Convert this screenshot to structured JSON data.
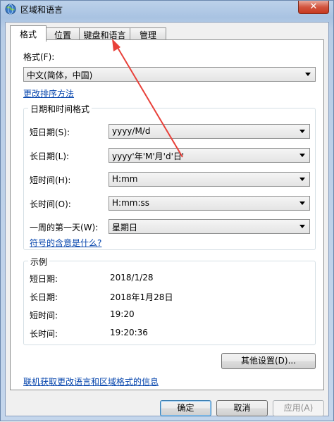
{
  "window": {
    "title": "区域和语言",
    "close_label": "✕"
  },
  "tabs": [
    {
      "label": "格式",
      "active": true
    },
    {
      "label": "位置",
      "active": false
    },
    {
      "label": "键盘和语言",
      "active": false
    },
    {
      "label": "管理",
      "active": false
    }
  ],
  "format": {
    "label": "格式(F):",
    "value": "中文(简体，中国)",
    "sort_link": "更改排序方法"
  },
  "datetime_group": {
    "title": "日期和时间格式",
    "rows": [
      {
        "label": "短日期(S):",
        "value": "yyyy/M/d"
      },
      {
        "label": "长日期(L):",
        "value": "yyyy'年'M'月'd'日'"
      },
      {
        "label": "短时间(H):",
        "value": "H:mm"
      },
      {
        "label": "长时间(O):",
        "value": "H:mm:ss"
      },
      {
        "label": "一周的第一天(W):",
        "value": "星期日"
      }
    ],
    "symbol_link": "符号的含意是什么?"
  },
  "example_group": {
    "title": "示例",
    "rows": [
      {
        "label": "短日期:",
        "value": "2018/1/28"
      },
      {
        "label": "长日期:",
        "value": "2018年1月28日"
      },
      {
        "label": "短时间:",
        "value": "19:20"
      },
      {
        "label": "长时间:",
        "value": "19:20:36"
      }
    ]
  },
  "other_settings_label": "其他设置(D)...",
  "online_link": "联机获取更改语言和区域格式的信息",
  "buttons": {
    "ok": "确定",
    "cancel": "取消",
    "apply": "应用(A)"
  },
  "colors": {
    "link": "#0645ad",
    "annotation_arrow": "#e8413a"
  }
}
